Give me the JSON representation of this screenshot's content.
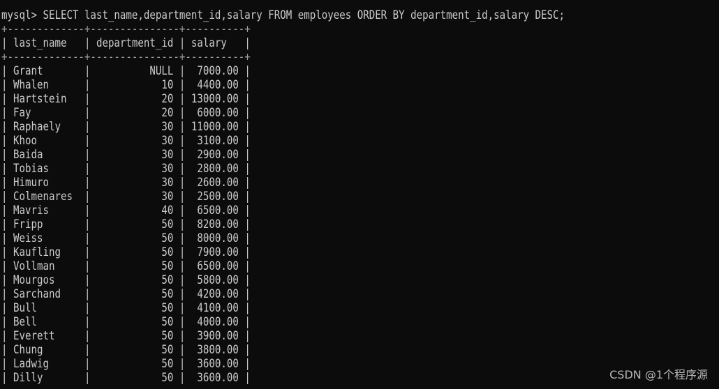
{
  "terminal": {
    "prompt": "mysql> ",
    "command": "SELECT last_name,department_id,salary FROM employees ORDER BY department_id,salary DESC;"
  },
  "result": {
    "columns": [
      "last_name",
      "department_id",
      "salary"
    ],
    "rows": [
      [
        "Grant",
        "NULL",
        "7000.00"
      ],
      [
        "Whalen",
        "10",
        "4400.00"
      ],
      [
        "Hartstein",
        "20",
        "13000.00"
      ],
      [
        "Fay",
        "20",
        "6000.00"
      ],
      [
        "Raphaely",
        "30",
        "11000.00"
      ],
      [
        "Khoo",
        "30",
        "3100.00"
      ],
      [
        "Baida",
        "30",
        "2900.00"
      ],
      [
        "Tobias",
        "30",
        "2800.00"
      ],
      [
        "Himuro",
        "30",
        "2600.00"
      ],
      [
        "Colmenares",
        "30",
        "2500.00"
      ],
      [
        "Mavris",
        "40",
        "6500.00"
      ],
      [
        "Fripp",
        "50",
        "8200.00"
      ],
      [
        "Weiss",
        "50",
        "8000.00"
      ],
      [
        "Kaufling",
        "50",
        "7900.00"
      ],
      [
        "Vollman",
        "50",
        "6500.00"
      ],
      [
        "Mourgos",
        "50",
        "5800.00"
      ],
      [
        "Sarchand",
        "50",
        "4200.00"
      ],
      [
        "Bull",
        "50",
        "4100.00"
      ],
      [
        "Bell",
        "50",
        "4000.00"
      ],
      [
        "Everett",
        "50",
        "3900.00"
      ],
      [
        "Chung",
        "50",
        "3800.00"
      ],
      [
        "Ladwig",
        "50",
        "3600.00"
      ],
      [
        "Dilly",
        "50",
        "3600.00"
      ]
    ]
  },
  "watermark": "CSDN @1个程序源",
  "colors": {
    "background": "#0c0c0c",
    "text": "#cccccc"
  }
}
